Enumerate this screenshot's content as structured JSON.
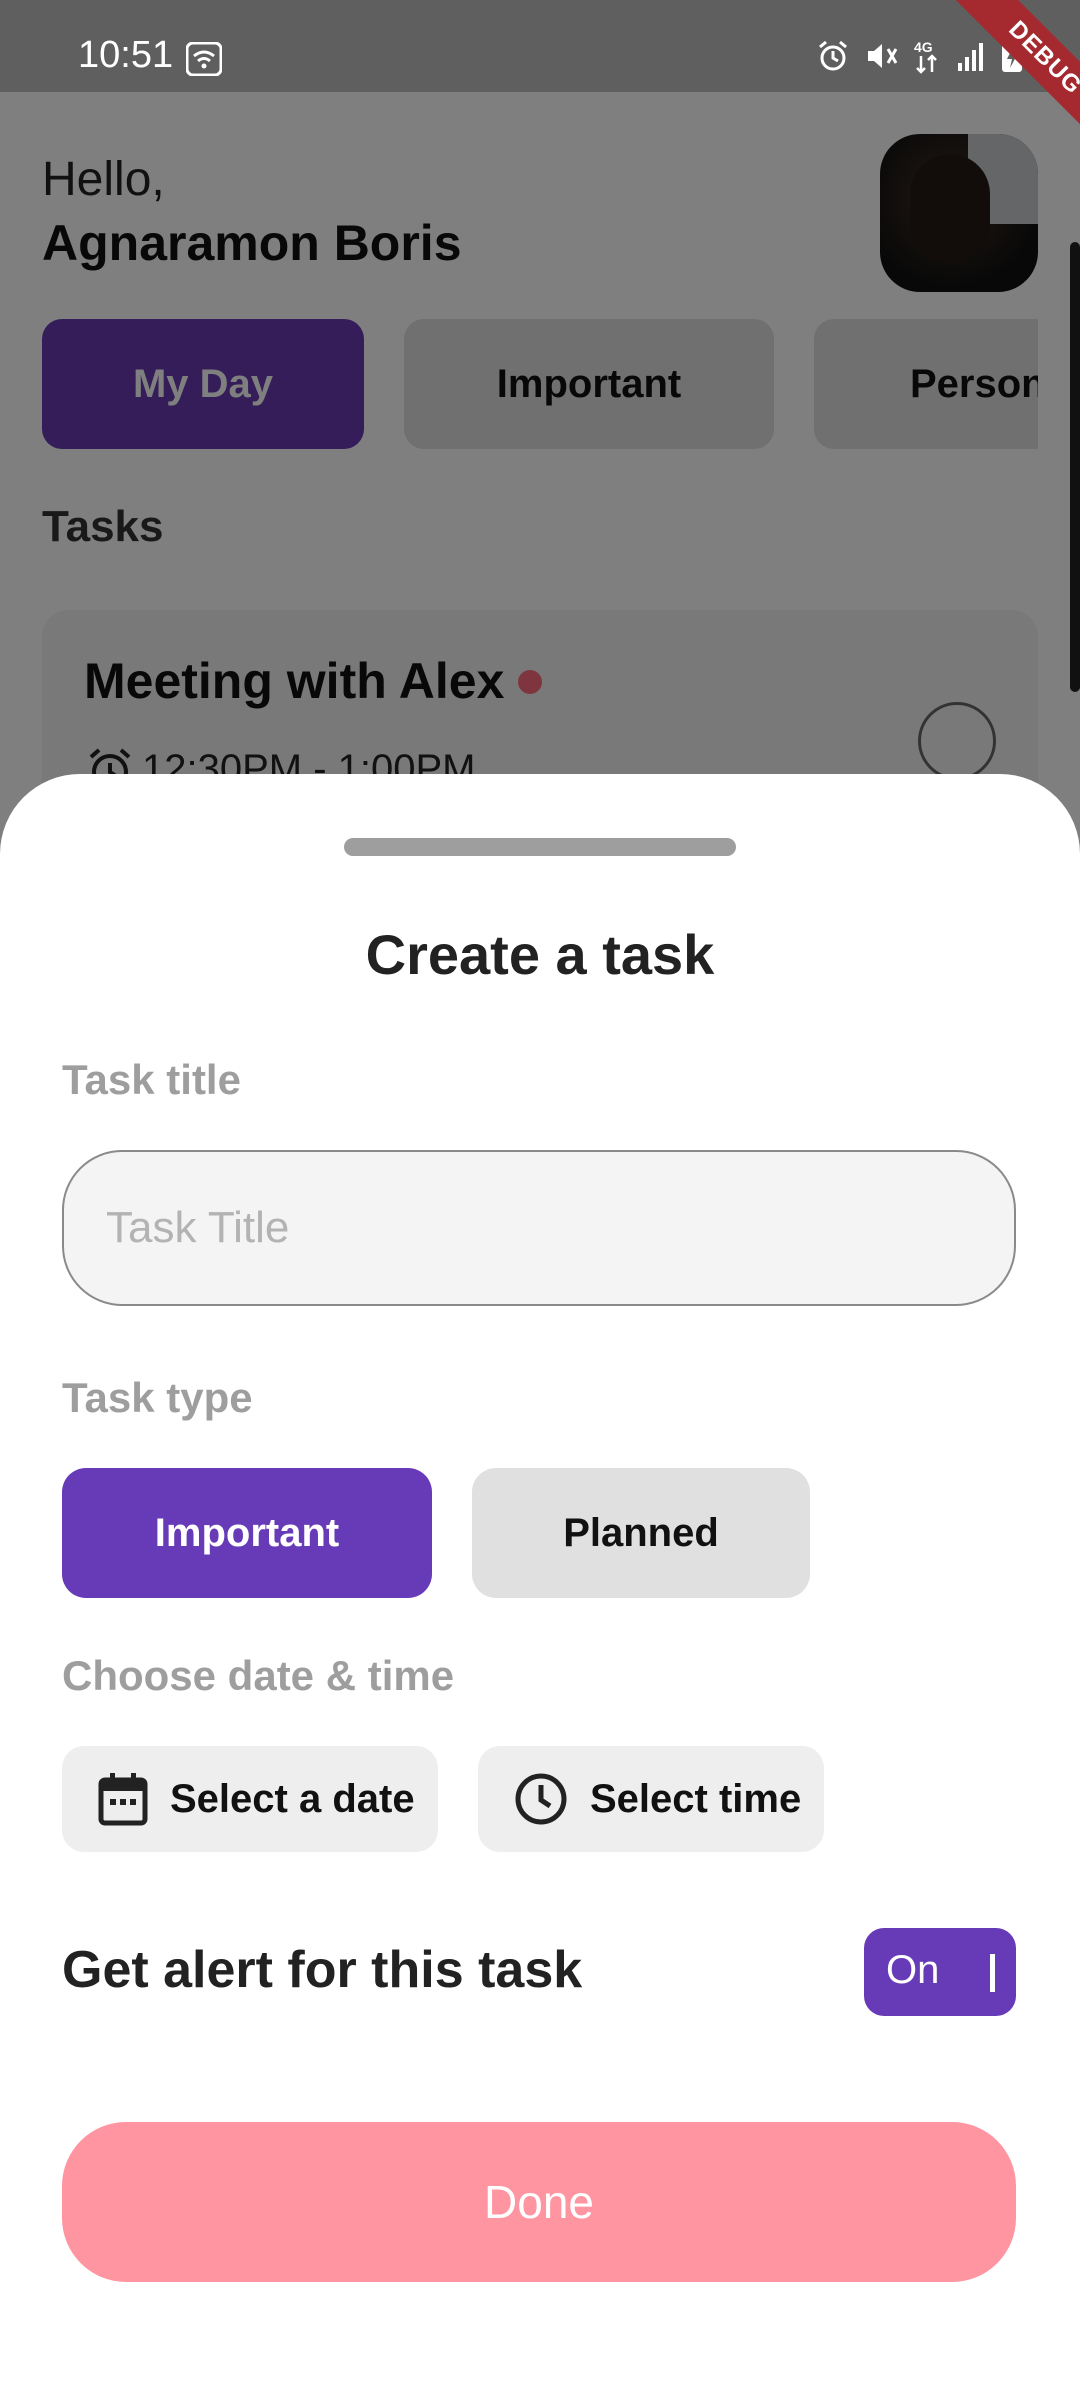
{
  "status_bar": {
    "time": "10:51",
    "icons": [
      "wifi-icon",
      "alarm-icon",
      "mute-icon",
      "4g-icon",
      "signal-icon",
      "battery-charging-icon"
    ]
  },
  "debug_banner": "DEBUG",
  "header": {
    "greeting": "Hello,",
    "user_name": "Agnaramon Boris"
  },
  "categories": [
    {
      "label": "My Day",
      "active": true
    },
    {
      "label": "Important",
      "active": false
    },
    {
      "label": "Person",
      "active": false
    }
  ],
  "tasks": {
    "heading": "Tasks",
    "items": [
      {
        "title": "Meeting with Alex",
        "time": "12:30PM - 1:00PM",
        "dot_color": "#ff6b7b"
      }
    ]
  },
  "sheet": {
    "title": "Create a task",
    "task_title_label": "Task title",
    "task_title_placeholder": "Task Title",
    "task_title_value": "",
    "task_type_label": "Task type",
    "task_types": [
      {
        "label": "Important",
        "selected": true
      },
      {
        "label": "Planned",
        "selected": false
      }
    ],
    "datetime_label": "Choose date & time",
    "select_date": "Select a date",
    "select_time": "Select time",
    "alert_label": "Get alert for this task",
    "alert_toggle": "On",
    "done": "Done"
  },
  "colors": {
    "accent": "#673ab7",
    "done_button": "#ff95a1",
    "label_gray": "#9e9e9e"
  }
}
